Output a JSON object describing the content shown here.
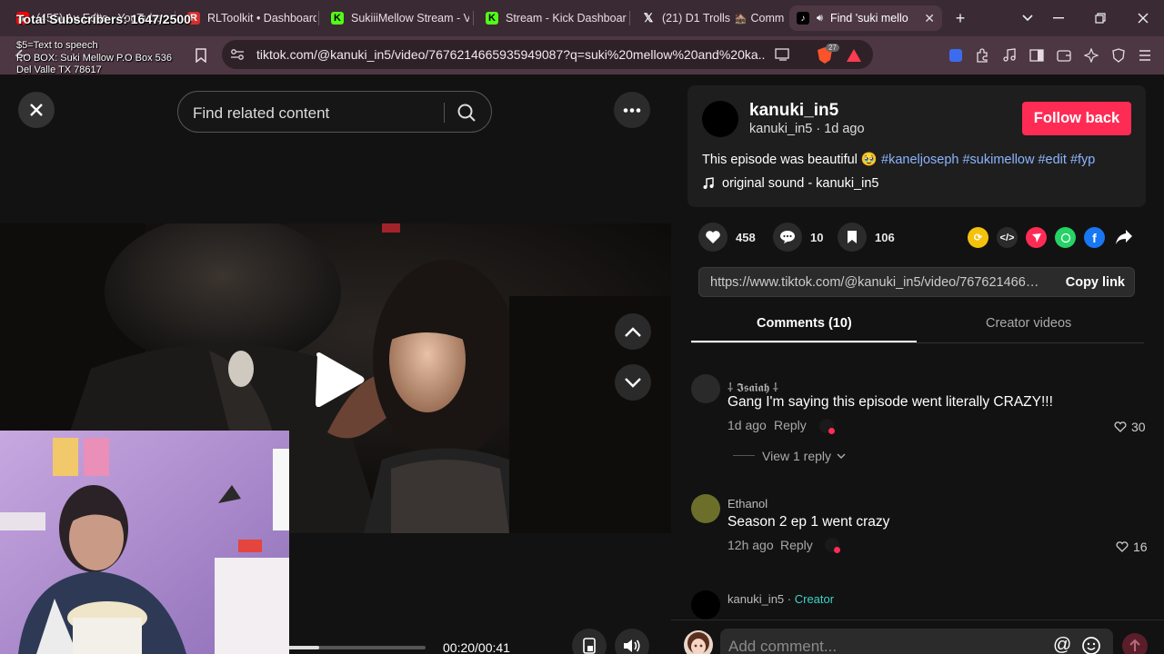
{
  "browser": {
    "tabs": [
      {
        "label": "(455) Au Edits - YouTube",
        "favicon": "youtube"
      },
      {
        "label": "RLToolkit • Dashboard",
        "favicon": "rltoolkit"
      },
      {
        "label": "SukiiiMellow Stream - V",
        "favicon": "kick"
      },
      {
        "label": "Stream - Kick Dashboar",
        "favicon": "kick"
      },
      {
        "label": "(21) D1 Trolls 🏚️ Comm",
        "favicon": "x"
      },
      {
        "label": "Find 'suki mello",
        "favicon": "tiktok",
        "active": true
      }
    ],
    "url": "tiktok.com/@kanuki_in5/video/7676214665935949087?q=suki%20mellow%20and%20ka...",
    "brave_badge": "27"
  },
  "stream_overlay": {
    "subscribers": "Total Subscribers: 1647/2500",
    "tts": "$5=Text to speech",
    "po_box_1": "PO BOX: Suki Mellow P.O Box 536",
    "po_box_2": "Del Valle TX 78617"
  },
  "player": {
    "search_placeholder": "Find related content",
    "time": "00:20/00:41",
    "progress": 0.4878
  },
  "post": {
    "username": "kanuki_in5",
    "handle_time": "kanuki_in5 · 1d ago",
    "follow_label": "Follow back",
    "caption_text": "This episode was beautiful 🥹",
    "hashtags": "#kaneljoseph #sukimellow #edit #fyp",
    "sound": "original sound - kanuki_in5",
    "likes": "458",
    "comments": "10",
    "saves": "106",
    "link": "https://www.tiktok.com/@kanuki_in5/video/7676214665935949087",
    "copy_label": "Copy link"
  },
  "tabs": {
    "comments_label": "Comments (10)",
    "creator_label": "Creator videos"
  },
  "comments": [
    {
      "name": "⸸ 𝕴𝖘𝖆𝖎𝖆𝖍 ⸸",
      "text": "Gang I'm saying this episode went literally CRAZY!!!",
      "time": "1d ago",
      "reply": "Reply",
      "likes": "30",
      "view_replies": "View 1 reply"
    },
    {
      "name": "Ethanol",
      "text": "Season 2 ep 1 went crazy",
      "time": "12h ago",
      "reply": "Reply",
      "likes": "16"
    },
    {
      "name": "kanuki_in5",
      "creator_tag": "Creator"
    }
  ],
  "comment_box": {
    "placeholder": "Add comment..."
  },
  "colors": {
    "accent": "#fe2c55",
    "hashtag": "#8cb4ff",
    "creator": "#3ed3c4"
  }
}
